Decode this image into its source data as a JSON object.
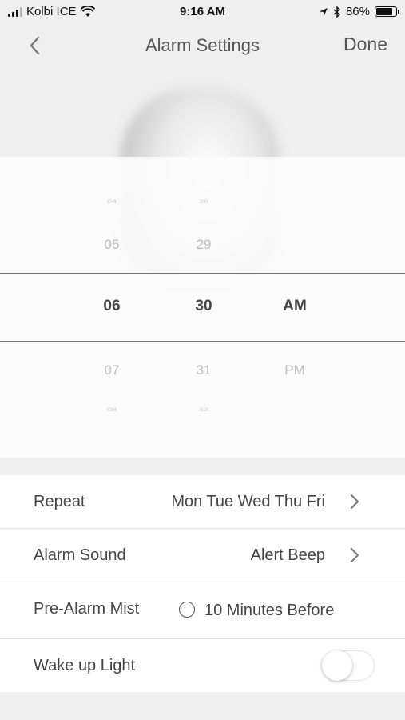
{
  "status_bar": {
    "carrier": "Kolbi ICE",
    "time": "9:16 AM",
    "battery": "86%",
    "battery_level": 0.86,
    "icons": [
      "signal-icon",
      "wifi-icon",
      "location-icon",
      "bluetooth-icon",
      "battery-icon"
    ]
  },
  "nav": {
    "title": "Alarm Settings",
    "done_label": "Done",
    "back_icon": "chevron-left-icon"
  },
  "picker": {
    "hours": [
      "04",
      "05",
      "06",
      "07",
      "08"
    ],
    "minutes": [
      "28",
      "29",
      "30",
      "31",
      "32"
    ],
    "periods": [
      "",
      "",
      "AM",
      "PM",
      ""
    ],
    "selected": {
      "hour": "06",
      "minute": "30",
      "period": "AM"
    }
  },
  "settings": {
    "repeat": {
      "label": "Repeat",
      "value": "Mon Tue Wed Thu Fri"
    },
    "alarm_sound": {
      "label": "Alarm Sound",
      "value": "Alert Beep"
    },
    "pre_alarm_mist": {
      "label": "Pre-Alarm Mist",
      "value": "10 Minutes Before",
      "checked": false
    },
    "wake_up_light": {
      "label": "Wake up Light",
      "on": false
    }
  }
}
